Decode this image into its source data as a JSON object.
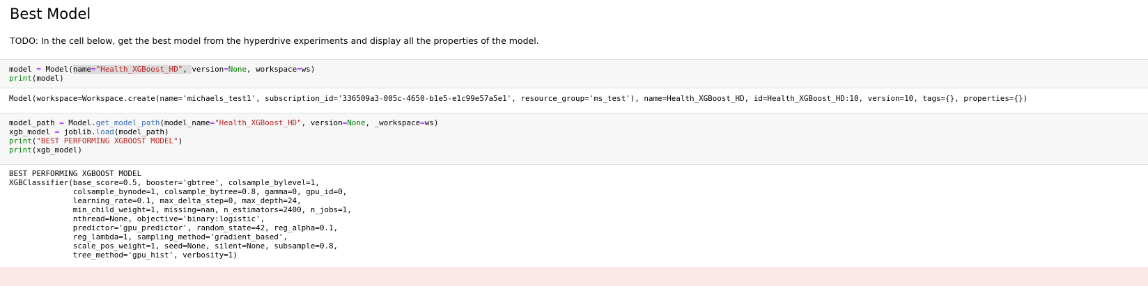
{
  "heading": "Best Model",
  "todo": "TODO: In the cell below, get the best model from the hyperdrive experiments and display all the properties of the model.",
  "cell1": {
    "l1": {
      "a": "model ",
      "eq": "=",
      "b": " Model(",
      "hl_a": "name",
      "hl_eq": "=",
      "hl_str": "\"Health_XGBoost_HD\"",
      "hl_b": ", ",
      "c": "version",
      "eq2": "=",
      "none": "None",
      "d": ", workspace",
      "eq3": "=",
      "e": "ws)"
    },
    "l2": {
      "print": "print",
      "rest": "(model)"
    }
  },
  "output1": "Model(workspace=Workspace.create(name='michaels_test1', subscription_id='336509a3-005c-4650-b1e5-e1c99e57a5e1', resource_group='ms_test'), name=Health_XGBoost_HD, id=Health_XGBoost_HD:10, version=10, tags={}, properties={})",
  "cell2": {
    "l1": {
      "a": "model_path ",
      "eq": "=",
      "b": " Model",
      "dot": ".",
      "fn": "get_model_path",
      "c": "(model_name",
      "eq2": "=",
      "str": "\"Health_XGBoost_HD\"",
      "d": ", version",
      "eq3": "=",
      "none": "None",
      "e": ", _workspace",
      "eq4": "=",
      "f": "ws)"
    },
    "l2": {
      "a": "xgb_model ",
      "eq": "=",
      "b": " joblib",
      "dot": ".",
      "fn": "load",
      "c": "(model_path)"
    },
    "l3": {
      "print": "print",
      "open": "(",
      "str": "\"BEST PERFORMING XGBOOST MODEL\"",
      "close": ")"
    },
    "l4": {
      "print": "print",
      "rest": "(xgb_model)"
    }
  },
  "output2": "BEST PERFORMING XGBOOST MODEL\nXGBClassifier(base_score=0.5, booster='gbtree', colsample_bylevel=1,\n              colsample_bynode=1, colsample_bytree=0.8, gamma=0, gpu_id=0,\n              learning_rate=0.1, max_delta_step=0, max_depth=24,\n              min_child_weight=1, missing=nan, n_estimators=2400, n_jobs=1,\n              nthread=None, objective='binary:logistic',\n              predictor='gpu_predictor', random_state=42, reg_alpha=0.1,\n              reg_lambda=1, sampling_method='gradient_based',\n              scale_pos_weight=1, seed=None, silent=None, subsample=0.8,\n              tree_method='gpu_hist', verbosity=1)"
}
